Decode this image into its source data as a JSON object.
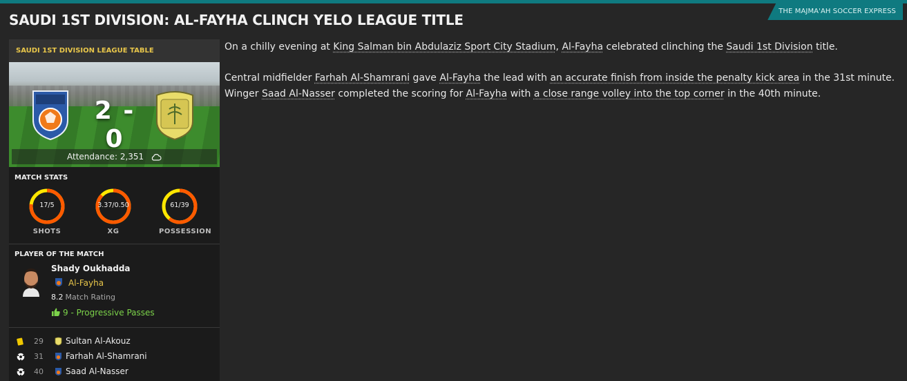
{
  "publication": "THE MAJMA'AH SOCCER EXPRESS",
  "headline": "SAUDI 1ST DIVISION: AL-FAYHA CLINCH YELO LEAGUE TITLE",
  "sidebar": {
    "table_link": "SAUDI 1ST DIVISION LEAGUE TABLE",
    "match": {
      "home_score": "2",
      "away_score": "0",
      "score_separator": "-",
      "attendance_label": "Attendance:",
      "attendance_value": "2,351",
      "weather_icon": "cloud-icon"
    },
    "stats_title": "MATCH STATS",
    "stats": [
      {
        "label": "SHOTS",
        "value": "17/5",
        "home_share": 0.77
      },
      {
        "label": "XG",
        "value": "3.37/0.50",
        "home_share": 0.87
      },
      {
        "label": "POSSESSION",
        "value": "61/39",
        "home_share": 0.61
      }
    ],
    "potm": {
      "title": "PLAYER OF THE MATCH",
      "name": "Shady Oukhadda",
      "club": "Al-Fayha",
      "rating": "8.2",
      "rating_label": "Match Rating",
      "stat": "9 - Progressive Passes"
    },
    "events": [
      {
        "type": "yellow-card-icon",
        "minute": "29",
        "player": "Sultan Al-Akouz",
        "team": "away"
      },
      {
        "type": "goal-ball-icon",
        "minute": "31",
        "player": "Farhah Al-Shamrani",
        "team": "home"
      },
      {
        "type": "goal-ball-icon",
        "minute": "40",
        "player": "Saad Al-Nasser",
        "team": "home"
      }
    ]
  },
  "article": {
    "p1": {
      "t1": "On a chilly evening at ",
      "l1": "King Salman bin Abdulaziz Sport City Stadium",
      "t2": ", ",
      "l2": "Al-Fayha",
      "t3": " celebrated clinching the ",
      "l3": "Saudi 1st Division",
      "t4": " title."
    },
    "p2": {
      "t1": "Central midfielder ",
      "l1": "Farhah Al-Shamrani",
      "t2": " gave ",
      "l2": "Al-Fayha",
      "t3": " the lead with ",
      "l3": "an accurate finish from inside the penalty kick area",
      "t4": " in the 31st minute.",
      "t5": "Winger ",
      "l4": "Saad Al-Nasser",
      "t6": " completed the scoring for ",
      "l5": "Al-Fayha",
      "t7": " with ",
      "l6": "a close range volley into the top corner",
      "t8": " in the 40th minute."
    }
  },
  "colors": {
    "accent": "#0f7a80",
    "gold": "#e8c64a",
    "gauge_home": "#ff5a00",
    "gauge_away": "#ffe600",
    "positive": "#7cd34a"
  }
}
